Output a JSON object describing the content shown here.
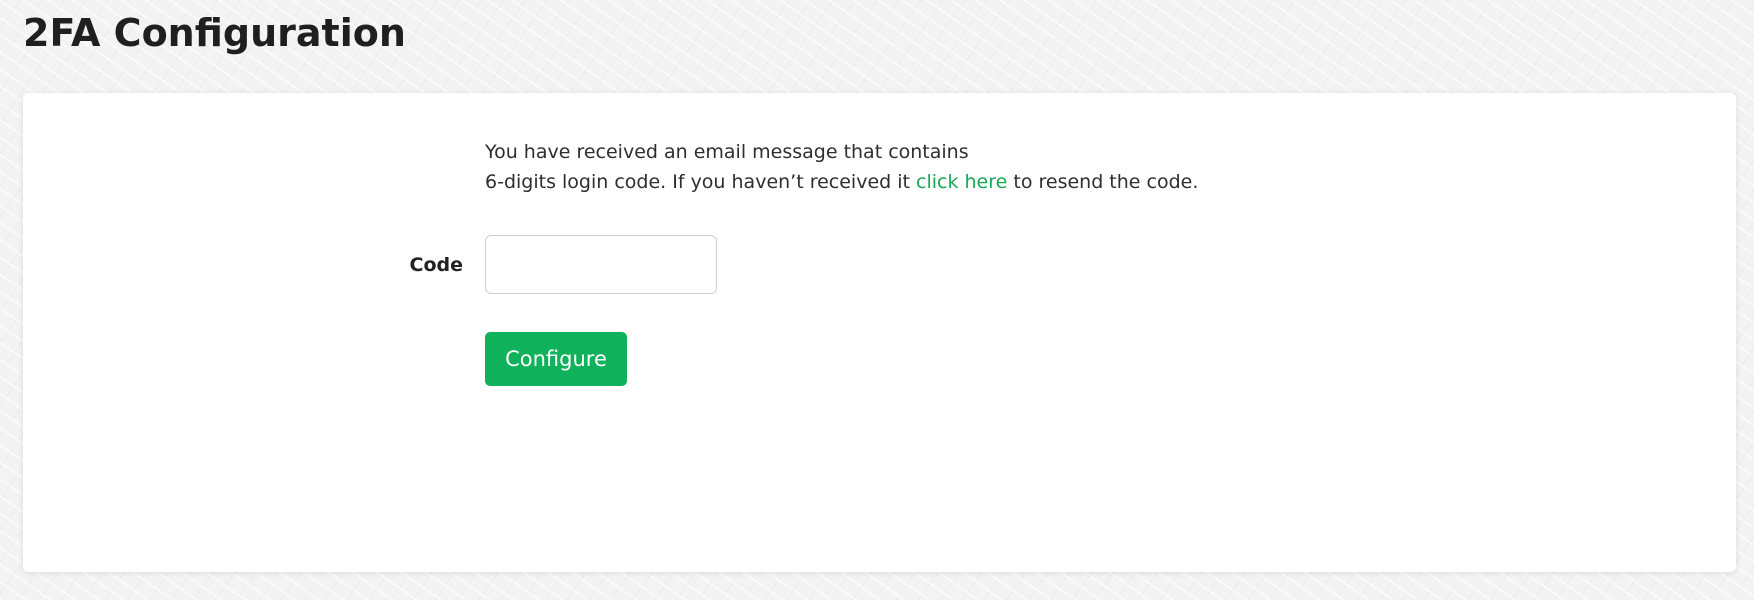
{
  "page": {
    "title": "2FA Configuration"
  },
  "form": {
    "message_line1": "You have received an email message that contains",
    "message_line2_before": "6-digits login code. If you haven’t received it ",
    "resend_link_label": "click here",
    "message_line2_after": " to resend the code.",
    "code_label": "Code",
    "code_value": "",
    "code_placeholder": "",
    "submit_label": "Configure"
  },
  "colors": {
    "accent": "#0fb25a",
    "link": "#1aa855",
    "background": "#f3f3f4",
    "card": "#ffffff"
  }
}
